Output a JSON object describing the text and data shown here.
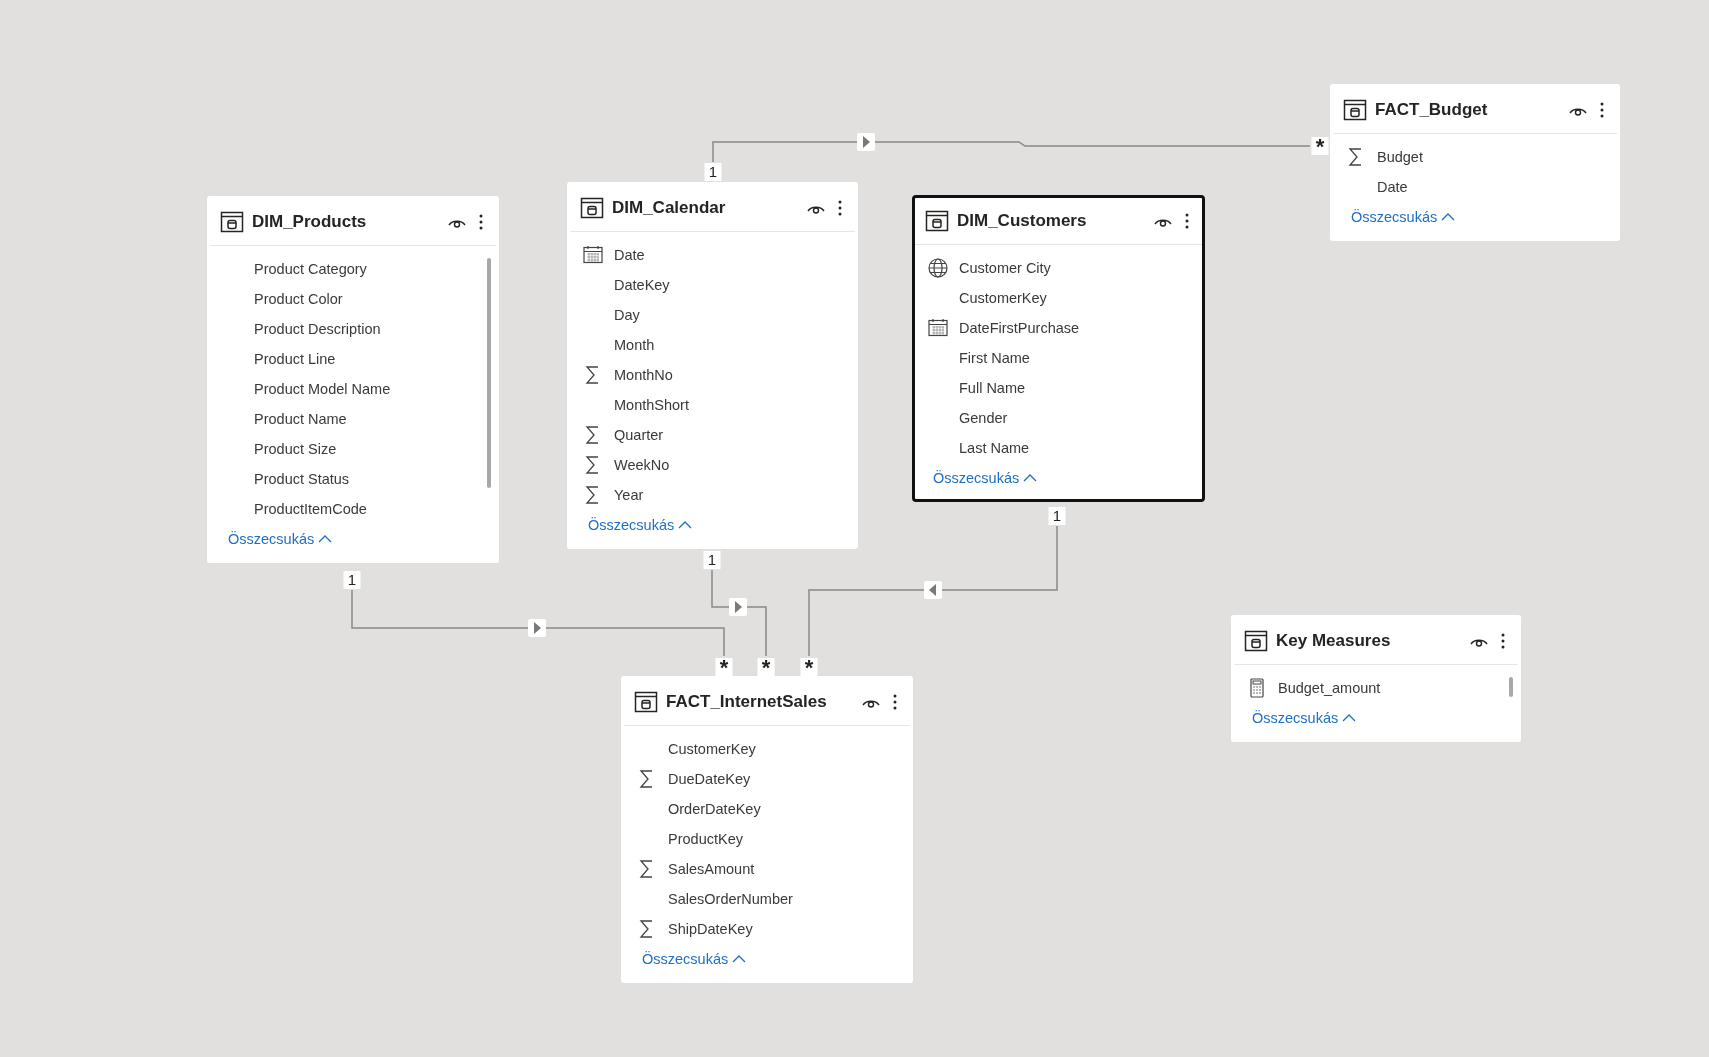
{
  "tables": [
    {
      "title": "DIM_Products",
      "selected": false,
      "scrollable": true,
      "collapse_label": "Összecsukás",
      "fields": [
        {
          "name": "Product Category",
          "kind": "plain"
        },
        {
          "name": "Product Color",
          "kind": "plain"
        },
        {
          "name": "Product Description",
          "kind": "plain"
        },
        {
          "name": "Product Line",
          "kind": "plain"
        },
        {
          "name": "Product Model Name",
          "kind": "plain"
        },
        {
          "name": "Product Name",
          "kind": "plain"
        },
        {
          "name": "Product Size",
          "kind": "plain"
        },
        {
          "name": "Product Status",
          "kind": "plain"
        },
        {
          "name": "ProductItemCode",
          "kind": "plain"
        }
      ]
    },
    {
      "title": "DIM_Calendar",
      "selected": false,
      "scrollable": false,
      "collapse_label": "Összecsukás",
      "fields": [
        {
          "name": "Date",
          "kind": "date"
        },
        {
          "name": "DateKey",
          "kind": "plain"
        },
        {
          "name": "Day",
          "kind": "plain"
        },
        {
          "name": "Month",
          "kind": "plain"
        },
        {
          "name": "MonthNo",
          "kind": "sum"
        },
        {
          "name": "MonthShort",
          "kind": "plain"
        },
        {
          "name": "Quarter",
          "kind": "sum"
        },
        {
          "name": "WeekNo",
          "kind": "sum"
        },
        {
          "name": "Year",
          "kind": "sum"
        }
      ]
    },
    {
      "title": "DIM_Customers",
      "selected": true,
      "scrollable": false,
      "collapse_label": "Összecsukás",
      "fields": [
        {
          "name": "Customer City",
          "kind": "geo"
        },
        {
          "name": "CustomerKey",
          "kind": "plain"
        },
        {
          "name": "DateFirstPurchase",
          "kind": "date"
        },
        {
          "name": "First Name",
          "kind": "plain"
        },
        {
          "name": "Full Name",
          "kind": "plain"
        },
        {
          "name": "Gender",
          "kind": "plain"
        },
        {
          "name": "Last Name",
          "kind": "plain"
        }
      ]
    },
    {
      "title": "FACT_Budget",
      "selected": false,
      "scrollable": false,
      "collapse_label": "Összecsukás",
      "fields": [
        {
          "name": "Budget",
          "kind": "sum"
        },
        {
          "name": "Date",
          "kind": "plain"
        }
      ]
    },
    {
      "title": "Key Measures",
      "selected": false,
      "scrollable": true,
      "collapse_label": "Összecsukás",
      "fields": [
        {
          "name": "Budget_amount",
          "kind": "measure"
        }
      ]
    },
    {
      "title": "FACT_InternetSales",
      "selected": false,
      "scrollable": false,
      "collapse_label": "Összecsukás",
      "fields": [
        {
          "name": "CustomerKey",
          "kind": "plain"
        },
        {
          "name": "DueDateKey",
          "kind": "sum"
        },
        {
          "name": "OrderDateKey",
          "kind": "plain"
        },
        {
          "name": "ProductKey",
          "kind": "plain"
        },
        {
          "name": "SalesAmount",
          "kind": "sum"
        },
        {
          "name": "SalesOrderNumber",
          "kind": "plain"
        },
        {
          "name": "ShipDateKey",
          "kind": "sum"
        }
      ]
    }
  ],
  "relationships": [
    {
      "one_label": "1",
      "many_label": "*"
    },
    {
      "one_label": "1",
      "many_label": "*"
    },
    {
      "one_label": "1",
      "many_label": "*"
    },
    {
      "one_label": "1",
      "many_label": "*"
    }
  ]
}
